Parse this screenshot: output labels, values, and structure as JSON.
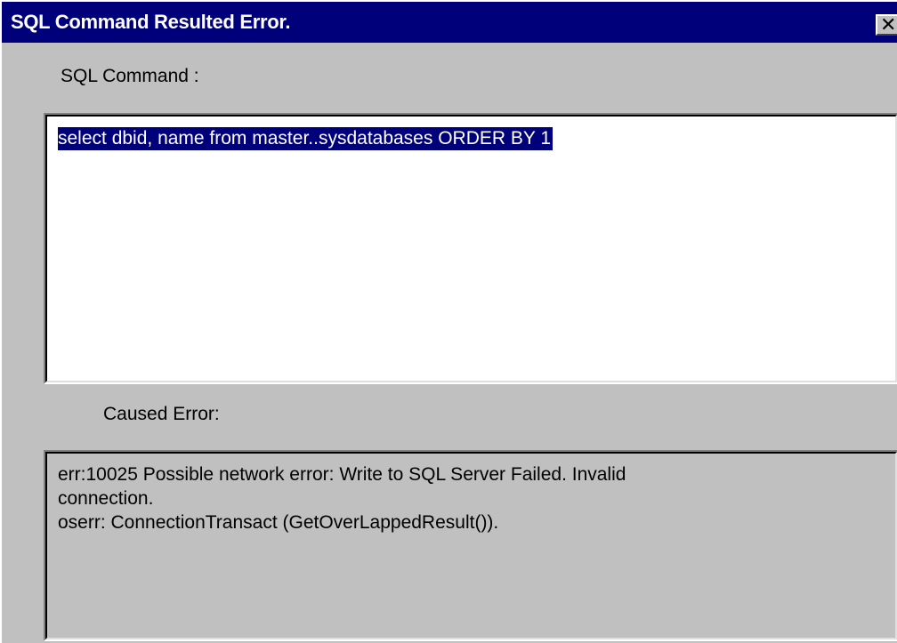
{
  "window": {
    "title": "SQL Command Resulted Error.",
    "close_glyph": "✕",
    "close_icon": "close-icon"
  },
  "sql_section": {
    "label": "SQL Command :",
    "command_text": "select dbid, name from master..sysdatabases ORDER BY 1"
  },
  "error_section": {
    "label": "Caused Error:",
    "lines": [
      "err:10025 Possible network error: Write to SQL Server Failed.  Invalid",
      "connection.",
      "oserr: ConnectionTransact (GetOverLappedResult())."
    ]
  },
  "colors": {
    "titlebar": "#00007b",
    "window_bg": "#c0c0c0",
    "selection_bg": "#00007b",
    "selection_fg": "#ffffff"
  }
}
